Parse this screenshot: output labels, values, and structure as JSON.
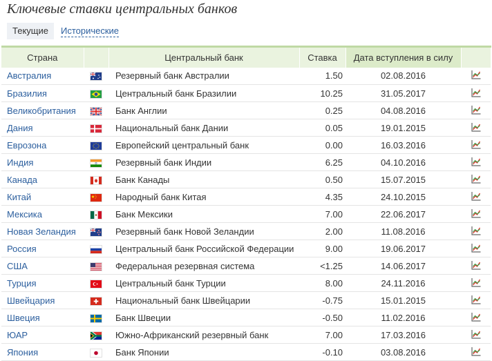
{
  "page": {
    "title": "Ключевые ставки центральных банков"
  },
  "tabs": {
    "current": "Текущие",
    "historical": "Исторические"
  },
  "table": {
    "headers": {
      "country": "Страна",
      "bank": "Центральный банк",
      "rate": "Ставка",
      "date": "Дата вступления в силу"
    },
    "rows": [
      {
        "country": "Австралия",
        "flag": "australia-flag-icon",
        "bank": "Резервный банк Австралии",
        "rate": "1.50",
        "date": "02.08.2016"
      },
      {
        "country": "Бразилия",
        "flag": "brazil-flag-icon",
        "bank": "Центральный банк Бразилии",
        "rate": "10.25",
        "date": "31.05.2017"
      },
      {
        "country": "Великобритания",
        "flag": "uk-flag-icon",
        "bank": "Банк Англии",
        "rate": "0.25",
        "date": "04.08.2016"
      },
      {
        "country": "Дания",
        "flag": "denmark-flag-icon",
        "bank": "Национальный банк Дании",
        "rate": "0.05",
        "date": "19.01.2015"
      },
      {
        "country": "Еврозона",
        "flag": "eu-flag-icon",
        "bank": "Европейский центральный банк",
        "rate": "0.00",
        "date": "16.03.2016"
      },
      {
        "country": "Индия",
        "flag": "india-flag-icon",
        "bank": "Резервный банк Индии",
        "rate": "6.25",
        "date": "04.10.2016"
      },
      {
        "country": "Канада",
        "flag": "canada-flag-icon",
        "bank": "Банк Канады",
        "rate": "0.50",
        "date": "15.07.2015"
      },
      {
        "country": "Китай",
        "flag": "china-flag-icon",
        "bank": "Народный банк Китая",
        "rate": "4.35",
        "date": "24.10.2015"
      },
      {
        "country": "Мексика",
        "flag": "mexico-flag-icon",
        "bank": "Банк Мексики",
        "rate": "7.00",
        "date": "22.06.2017"
      },
      {
        "country": "Новая Зеландия",
        "flag": "new-zealand-flag-icon",
        "bank": "Резервный банк Новой Зеландии",
        "rate": "2.00",
        "date": "11.08.2016"
      },
      {
        "country": "Россия",
        "flag": "russia-flag-icon",
        "bank": "Центральный банк Российской Федерации",
        "rate": "9.00",
        "date": "19.06.2017"
      },
      {
        "country": "США",
        "flag": "usa-flag-icon",
        "bank": "Федеральная резервная система",
        "rate": "<1.25",
        "date": "14.06.2017"
      },
      {
        "country": "Турция",
        "flag": "turkey-flag-icon",
        "bank": "Центральный банк Турции",
        "rate": "8.00",
        "date": "24.11.2016"
      },
      {
        "country": "Швейцария",
        "flag": "switzerland-flag-icon",
        "bank": "Национальный банк Швейцарии",
        "rate": "-0.75",
        "date": "15.01.2015"
      },
      {
        "country": "Швеция",
        "flag": "sweden-flag-icon",
        "bank": "Банк Швеции",
        "rate": "-0.50",
        "date": "11.02.2016"
      },
      {
        "country": "ЮАР",
        "flag": "south-africa-flag-icon",
        "bank": "Южно-Африканский резервный банк",
        "rate": "7.00",
        "date": "17.03.2016"
      },
      {
        "country": "Япония",
        "flag": "japan-flag-icon",
        "bank": "Банк Японии",
        "rate": "-0.10",
        "date": "03.08.2016"
      }
    ]
  },
  "colors": {
    "link": "#2c5f9e",
    "header_bg": "#eaf3df",
    "header_border": "#bfd9a4"
  }
}
